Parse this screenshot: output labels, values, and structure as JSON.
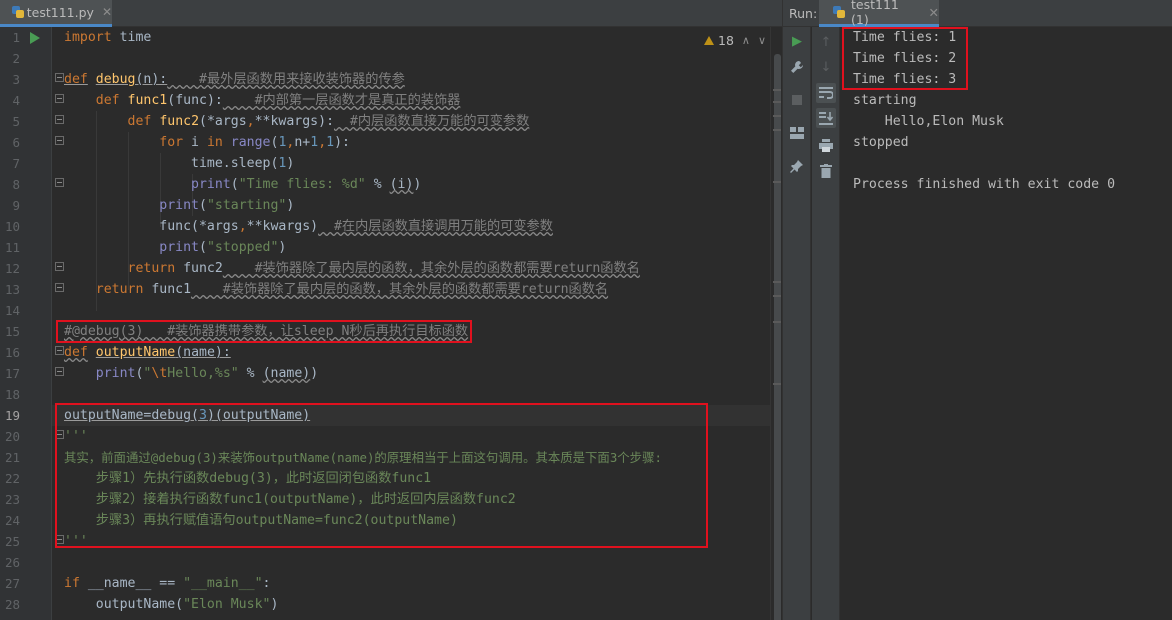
{
  "editor": {
    "tab_name": "test111.py",
    "inspection_count": "18",
    "current_line": "19",
    "lines": [
      {
        "n": "1"
      },
      {
        "n": "2"
      },
      {
        "n": "3"
      },
      {
        "n": "4"
      },
      {
        "n": "5"
      },
      {
        "n": "6"
      },
      {
        "n": "7"
      },
      {
        "n": "8"
      },
      {
        "n": "9"
      },
      {
        "n": "10"
      },
      {
        "n": "11"
      },
      {
        "n": "12"
      },
      {
        "n": "13"
      },
      {
        "n": "14"
      },
      {
        "n": "15"
      },
      {
        "n": "16"
      },
      {
        "n": "17"
      },
      {
        "n": "18"
      },
      {
        "n": "19"
      },
      {
        "n": "20"
      },
      {
        "n": "21"
      },
      {
        "n": "22"
      },
      {
        "n": "23"
      },
      {
        "n": "24"
      },
      {
        "n": "25"
      },
      {
        "n": "26"
      },
      {
        "n": "27"
      },
      {
        "n": "28"
      }
    ],
    "code": {
      "l1_kw": "import",
      "l1_mod": " time",
      "l3_kw": "def",
      "l3_fn": "debug",
      "l3_sig": "(n):",
      "l3_cm": "    #最外层函数用来接收装饰器的传参",
      "l4_kw": "def",
      "l4_fn": "func1",
      "l4_sig": "(func):",
      "l4_cm": "    #内部第一层函数才是真正的装饰器",
      "l5_kw": "def",
      "l5_fn": "func2",
      "l5_a": "(*args",
      "l5_b": "**kwargs):",
      "l5_cm": "  #内层函数直接万能的可变参数",
      "l6_kw1": "for",
      "l6_i": " i ",
      "l6_kw2": "in",
      "l6_range": "range",
      "l6_p1": "(",
      "l6_n1": "1",
      "l6_mid": "n+",
      "l6_n2": "1",
      "l6_n3": "1",
      "l6_p2": "):",
      "l7_a": "time.sleep(",
      "l7_n": "1",
      "l7_b": ")",
      "l8_bi": "print",
      "l8_p": "(",
      "l8_st": "\"Time flies: %d\"",
      "l8_op": " % ",
      "l8_arg": "(i)",
      "l8_end": ")",
      "l9_bi": "print",
      "l9_p": "(",
      "l9_st": "\"starting\"",
      "l9_end": ")",
      "l10_a": "func(*args",
      "l10_b": "**kwargs)",
      "l10_cm": "  #在内层函数直接调用万能的可变参数",
      "l11_bi": "print",
      "l11_p": "(",
      "l11_st": "\"stopped\"",
      "l11_end": ")",
      "l12_kw": "return",
      "l12_v": " func2",
      "l12_cm": "    #装饰器除了最内层的函数，其余外层的函数都需要return函数名",
      "l13_kw": "return",
      "l13_v": " func1",
      "l13_cm": "    #装饰器除了最内层的函数，其余外层的函数都需要return函数名",
      "l15_cm": "#@debug(3)   #装饰器携带参数，让sleep N秒后再执行目标函数",
      "l16_kw": "def",
      "l16_fn": "outputName",
      "l16_sig": "(name):",
      "l17_bi": "print",
      "l17_p": "(",
      "l17_st1": "\"",
      "l17_esc": "\\t",
      "l17_st2": "Hello,%s\"",
      "l17_op": " % ",
      "l17_arg": "(name)",
      "l17_end": ")",
      "l19_a": "outputName=debug(",
      "l19_n": "3",
      "l19_b": ")(outputName)",
      "l20": "'''",
      "l21": "其实，前面通过@debug(3)来装饰outputName(name)的原理相当于上面这句调用。其本质是下面3个步骤:",
      "l22": "    步骤1）先执行函数debug(3)，此时返回闭包函数func1",
      "l23": "    步骤2）接着执行函数func1(outputName)，此时返回内层函数func2",
      "l24": "    步骤3）再执行赋值语句outputName=func2(outputName)",
      "l25": "'''",
      "l27_kw": "if",
      "l27_a": " __name__ == ",
      "l27_st": "\"__main__\"",
      "l27_b": ":",
      "l28_a": "outputName(",
      "l28_st": "\"Elon Musk\"",
      "l28_b": ")"
    }
  },
  "run_panel": {
    "label": "Run:",
    "tab_name": "test111 (1)",
    "output": [
      "Time flies: 1",
      "Time flies: 2",
      "Time flies: 3",
      "starting",
      "    Hello,Elon Musk",
      "stopped",
      "",
      "Process finished with exit code 0"
    ]
  },
  "colors": {
    "highlight_box": "#e0111e",
    "keyword": "#cc7832",
    "function": "#ffc66d",
    "string": "#6a8759",
    "comment": "#808080",
    "number": "#6897bb"
  },
  "icons": {
    "toolbar_left": [
      "run-icon",
      "wrench-icon",
      "stop-icon",
      "layout-icon",
      "pin-icon"
    ],
    "toolbar_right": [
      "up-arrow-icon",
      "down-arrow-icon",
      "soft-wrap-icon",
      "scroll-to-end-icon",
      "print-icon",
      "trash-icon"
    ]
  }
}
